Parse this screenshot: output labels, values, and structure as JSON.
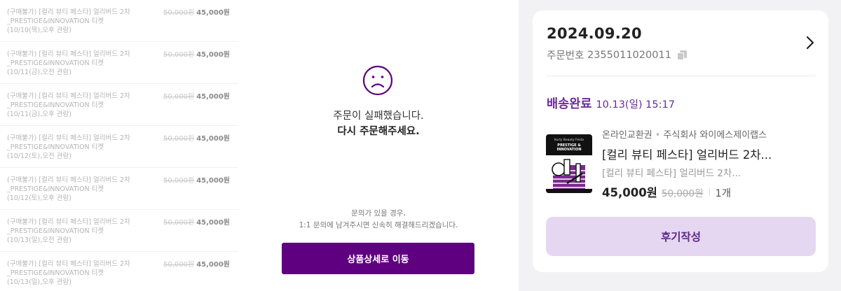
{
  "product_list": [
    {
      "name": "(구매불가) [컬리 뷰티 페스타] 얼리버드 2차 _PRESTIGE&INNOVATION 티켓 (10/10(목),오후 관람)",
      "original_price": "50,000원",
      "price": "45,000원"
    },
    {
      "name": "(구매불가) [컬리 뷰티 페스타] 얼리버드 2차 _PRESTIGE&INNOVATION 티켓 (10/11(금),오전 관람)",
      "original_price": "50,000원",
      "price": "45,000원"
    },
    {
      "name": "(구매불가) [컬리 뷰티 페스타] 얼리버드 2차 _PRESTIGE&INNOVATION 티켓 (10/11(금),오후 관람)",
      "original_price": "50,000원",
      "price": "45,000원"
    },
    {
      "name": "(구매불가) [컬리 뷰티 페스타] 얼리버드 2차 _PRESTIGE&INNOVATION 티켓 (10/12(토),오전 관람)",
      "original_price": "50,000원",
      "price": "45,000원"
    },
    {
      "name": "(구매불가) [컬리 뷰티 페스타] 얼리버드 2차 _PRESTIGE&INNOVATION 티켓 (10/12(토),오후 관람)",
      "original_price": "50,000원",
      "price": "45,000원"
    },
    {
      "name": "(구매불가) [컬리 뷰티 페스타] 얼리버드 2차 _PRESTIGE&INNOVATION 티켓 (10/13(일),오전 관람)",
      "original_price": "50,000원",
      "price": "45,000원"
    },
    {
      "name": "(구매불가) [컬리 뷰티 페스타] 얼리버드 2차 _PRESTIGE&INNOVATION 티켓 (10/13(일),오후 관람)",
      "original_price": "50,000원",
      "price": "45,000원"
    }
  ],
  "error_page": {
    "icon": "sad-face-icon",
    "message_line1": "주문이 실패했습니다.",
    "message_line2": "다시 주문해주세요.",
    "help_line1": "문의가 있을 경우,",
    "help_line2": "1:1 문의에 남겨주시면 신속히 해결해드리겠습니다.",
    "button_label": "상품상세로 이동"
  },
  "order_card": {
    "date": "2024.09.20",
    "order_number_label": "주문번호",
    "order_number": "2355011020011",
    "status": "배송완료",
    "status_time": "10.13(일) 15:17",
    "seller_category": "온라인교환권",
    "seller_separator": "•",
    "seller_name": "주식회사 와이에스제이랩스",
    "thumbnail_brand": "Kurly Beauty Festa",
    "thumbnail_title_1": "PRESTIGE &",
    "thumbnail_title_2": "INNOVATION",
    "product_name": "[컬리 뷰티 페스타] 얼리버드 2차...",
    "product_option": "[컬리 뷰티 페스타] 얼리버드 2차...",
    "price": "45,000원",
    "original_price": "50,000원",
    "quantity": "1개",
    "review_button_label": "후기작성"
  },
  "colors": {
    "brand_purple": "#5f0080",
    "status_purple": "#6b2a9a",
    "review_button_bg": "#e5d7f2",
    "page_bg_right": "#f2f2f4"
  }
}
